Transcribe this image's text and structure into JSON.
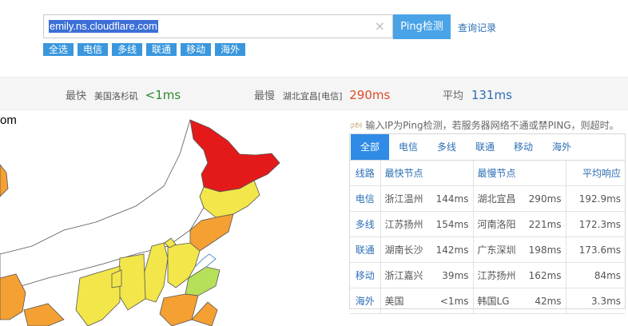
{
  "search": {
    "value": "emily.ns.cloudflare.com",
    "clear_icon": "×"
  },
  "ping_button": "Ping检测",
  "history_link": "查询记录",
  "filters": [
    "全选",
    "电信",
    "多线",
    "联通",
    "移动",
    "海外"
  ],
  "stats": {
    "fastest": {
      "label": "最快",
      "location": "美国洛杉矶",
      "value": "<1ms",
      "color": "#2f8a2f"
    },
    "slowest": {
      "label": "最慢",
      "location": "湖北宜昌[电信]",
      "value": "290ms",
      "color": "#e04a2a"
    },
    "average": {
      "label": "平均",
      "value": "131ms",
      "color": "#2c6fb5"
    }
  },
  "map_label": "om",
  "tip": {
    "icon": "speaker-icon",
    "text": "输入IP为Ping检测，若服务器网络不通或禁PING，则超时。"
  },
  "tabs": [
    "全部",
    "电信",
    "多线",
    "联通",
    "移动",
    "海外"
  ],
  "table": {
    "headers": [
      "线路",
      "最快节点",
      "最慢节点",
      "平均响应"
    ],
    "rows": [
      {
        "line": "电信",
        "fast_node": "浙江温州",
        "fast_ms": "144ms",
        "slow_node": "湖北宜昌",
        "slow_ms": "290ms",
        "avg": "192.9ms"
      },
      {
        "line": "多线",
        "fast_node": "江苏扬州",
        "fast_ms": "154ms",
        "slow_node": "河南洛阳",
        "slow_ms": "221ms",
        "avg": "172.3ms"
      },
      {
        "line": "联通",
        "fast_node": "湖南长沙",
        "fast_ms": "142ms",
        "slow_node": "广东深圳",
        "slow_ms": "198ms",
        "avg": "173.6ms"
      },
      {
        "line": "移动",
        "fast_node": "浙江嘉兴",
        "fast_ms": "39ms",
        "slow_node": "江苏扬州",
        "slow_ms": "162ms",
        "avg": "84ms"
      },
      {
        "line": "海外",
        "fast_node": "美国",
        "fast_ms": "<1ms",
        "slow_node": "韩国LG",
        "slow_ms": "42ms",
        "avg": "3.3ms"
      }
    ]
  },
  "colors": {
    "accent": "#2f8be6",
    "chip": "#3a97dd",
    "heat_red": "#e41a1a",
    "heat_orange": "#f5a033",
    "heat_yellow": "#f2e64a",
    "heat_green": "#b6e05a"
  }
}
